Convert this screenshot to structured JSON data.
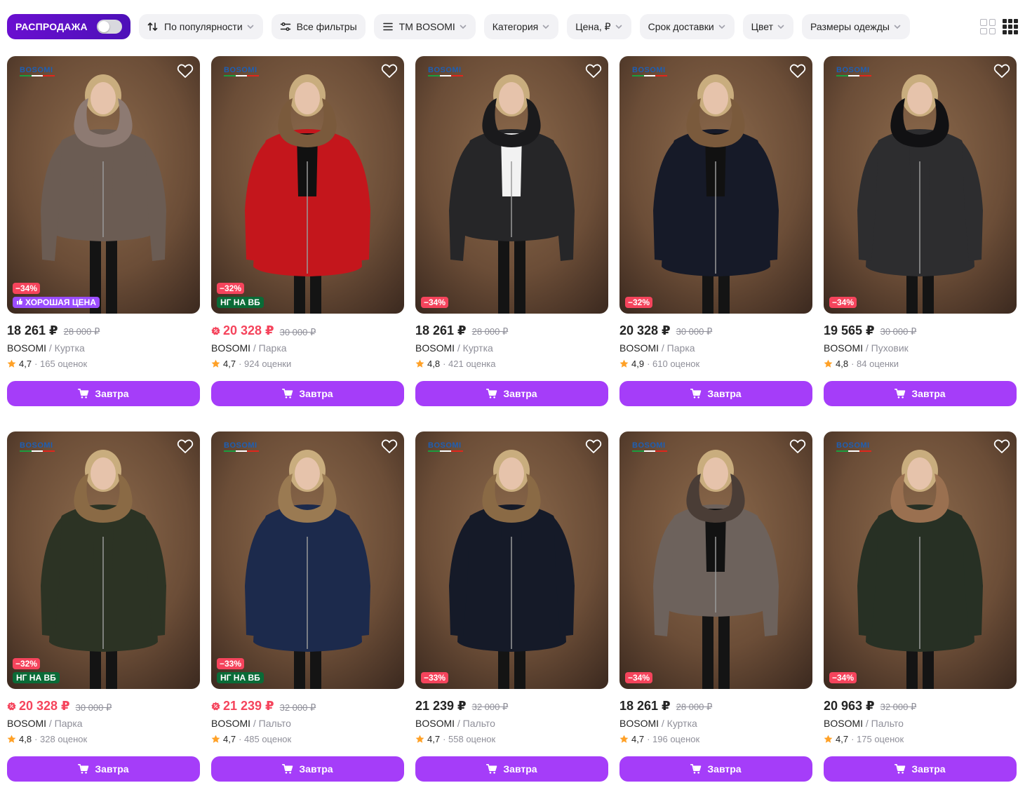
{
  "filters": {
    "sale_label": "РАСПРОДАЖА",
    "sort_label": "По популярности",
    "all_filters_label": "Все фильтры",
    "brand_label": "ТМ BOSOMI",
    "category_label": "Категория",
    "price_label": "Цена, ₽",
    "delivery_label": "Срок доставки",
    "color_label": "Цвет",
    "sizes_label": "Размеры одежды"
  },
  "colors": {
    "accent": "#a53df9",
    "sale": "#5a0fc8",
    "discount": "#f5445c",
    "good_price": "#9b4dff",
    "ng": "#0a6b37"
  },
  "products": [
    {
      "price": "18 261 ₽",
      "old_price": "28 000 ₽",
      "brand": "BOSOMI",
      "category": " / Куртка",
      "rating": "4,7",
      "reviews": "· 165 оценок",
      "discount": "−34%",
      "badge": "ХОРОШАЯ ЦЕНА",
      "badge_type": "good",
      "price_red": false,
      "coat": "#6b5c53",
      "fur": "#8d7a72",
      "inner": "#6b5c53",
      "long": false,
      "buy_label": "Завтра"
    },
    {
      "price": "20 328 ₽",
      "old_price": "30 000 ₽",
      "brand": "BOSOMI",
      "category": " / Парка",
      "rating": "4,7",
      "reviews": "· 924 оценки",
      "discount": "−32%",
      "badge": "НГ НА ВБ",
      "badge_type": "ng",
      "price_red": true,
      "coat": "#c4161c",
      "fur": "#7a5a3c",
      "inner": "#111111",
      "long": true,
      "buy_label": "Завтра"
    },
    {
      "price": "18 261 ₽",
      "old_price": "28 000 ₽",
      "brand": "BOSOMI",
      "category": " / Куртка",
      "rating": "4,8",
      "reviews": "· 421 оценка",
      "discount": "−34%",
      "badge": "",
      "badge_type": "",
      "price_red": false,
      "coat": "#262628",
      "fur": "#1a1a1c",
      "inner": "#f2f2f2",
      "long": false,
      "buy_label": "Завтра"
    },
    {
      "price": "20 328 ₽",
      "old_price": "30 000 ₽",
      "brand": "BOSOMI",
      "category": " / Парка",
      "rating": "4,9",
      "reviews": "· 610 оценок",
      "discount": "−32%",
      "badge": "",
      "badge_type": "",
      "price_red": false,
      "coat": "#161a28",
      "fur": "#7a5a3c",
      "inner": "#111111",
      "long": true,
      "buy_label": "Завтра"
    },
    {
      "price": "19 565 ₽",
      "old_price": "30 000 ₽",
      "brand": "BOSOMI",
      "category": " / Пуховик",
      "rating": "4,8",
      "reviews": "· 84 оценки",
      "discount": "−34%",
      "badge": "",
      "badge_type": "",
      "price_red": false,
      "coat": "#2d2d2f",
      "fur": "#111113",
      "inner": "#2d2d2f",
      "long": true,
      "buy_label": "Завтра"
    },
    {
      "price": "20 328 ₽",
      "old_price": "30 000 ₽",
      "brand": "BOSOMI",
      "category": " / Парка",
      "rating": "4,8",
      "reviews": "· 328 оценок",
      "discount": "−32%",
      "badge": "НГ НА ВБ",
      "badge_type": "ng",
      "price_red": true,
      "coat": "#2c3324",
      "fur": "#8a6a45",
      "inner": "#2c3324",
      "long": true,
      "buy_label": "Завтра"
    },
    {
      "price": "21 239 ₽",
      "old_price": "32 000 ₽",
      "brand": "BOSOMI",
      "category": " / Пальто",
      "rating": "4,7",
      "reviews": "· 485 оценок",
      "discount": "−33%",
      "badge": "НГ НА ВБ",
      "badge_type": "ng",
      "price_red": true,
      "coat": "#1c2a4c",
      "fur": "#9a7a52",
      "inner": "#1c2a4c",
      "long": true,
      "buy_label": "Завтра"
    },
    {
      "price": "21 239 ₽",
      "old_price": "32 000 ₽",
      "brand": "BOSOMI",
      "category": " / Пальто",
      "rating": "4,7",
      "reviews": "· 558 оценок",
      "discount": "−33%",
      "badge": "",
      "badge_type": "",
      "price_red": false,
      "coat": "#151a28",
      "fur": "#8a6a45",
      "inner": "#151a28",
      "long": true,
      "buy_label": "Завтра"
    },
    {
      "price": "18 261 ₽",
      "old_price": "28 000 ₽",
      "brand": "BOSOMI",
      "category": " / Куртка",
      "rating": "4,7",
      "reviews": "· 196 оценок",
      "discount": "−34%",
      "badge": "",
      "badge_type": "",
      "price_red": false,
      "coat": "#6d625c",
      "fur": "#4a3d36",
      "inner": "#121212",
      "long": false,
      "buy_label": "Завтра"
    },
    {
      "price": "20 963 ₽",
      "old_price": "32 000 ₽",
      "brand": "BOSOMI",
      "category": " / Пальто",
      "rating": "4,7",
      "reviews": "· 175 оценок",
      "discount": "−34%",
      "badge": "",
      "badge_type": "",
      "price_red": false,
      "coat": "#273024",
      "fur": "#9a7050",
      "inner": "#273024",
      "long": true,
      "buy_label": "Завтра"
    }
  ]
}
